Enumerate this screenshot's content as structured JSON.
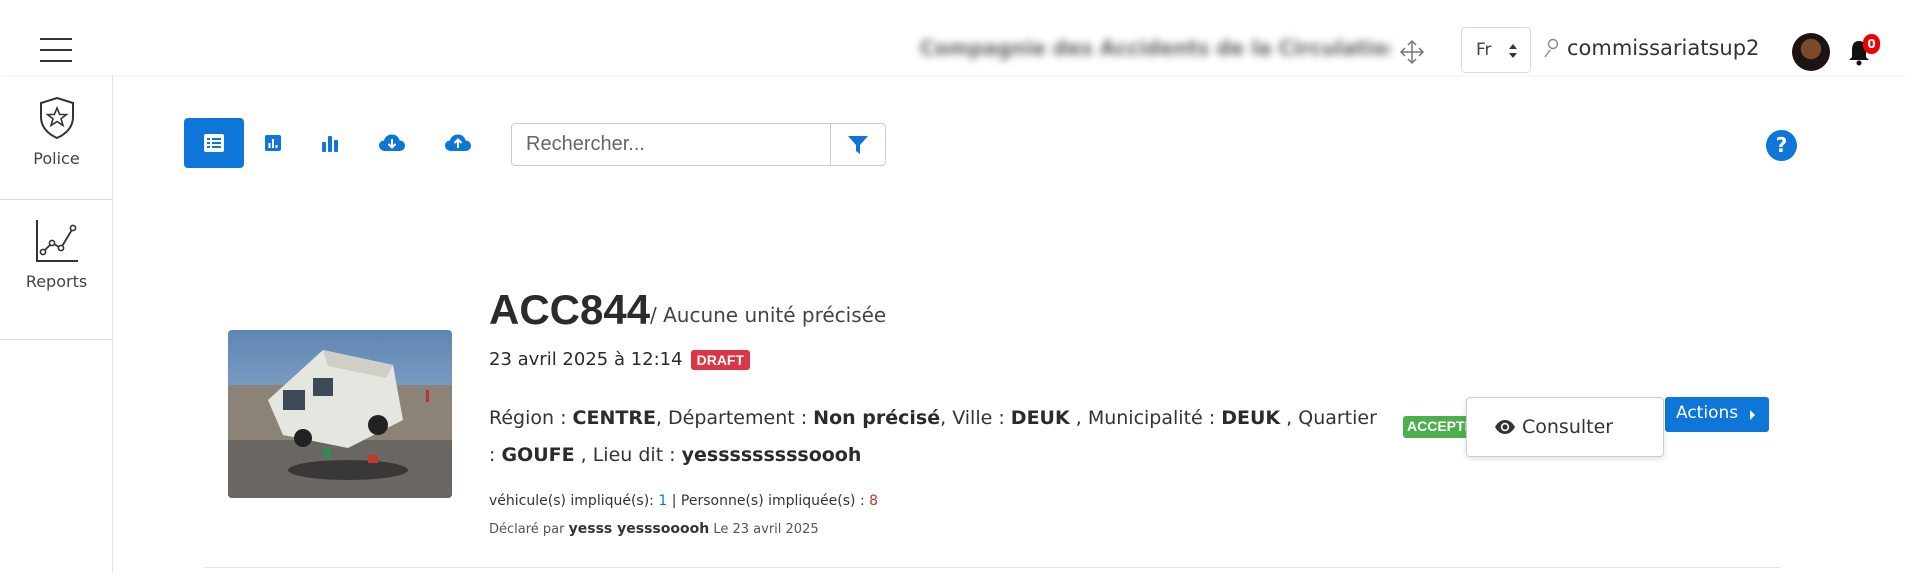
{
  "header": {
    "company_name": "Compagnie des Accidents de la Circulation DLA",
    "language": "Fr",
    "username": "commissariatsup2",
    "notification_count": "0"
  },
  "sidebar": {
    "items": [
      {
        "label": "Police",
        "icon": "shield-star-icon"
      },
      {
        "label": "Reports",
        "icon": "line-chart-icon"
      }
    ]
  },
  "toolbar": {
    "buttons": [
      "list-icon",
      "bar-chart-small-icon",
      "bar-chart-icon",
      "cloud-download-icon",
      "cloud-upload-icon"
    ],
    "search_placeholder": "Rechercher...",
    "help_label": "?"
  },
  "accident": {
    "code": "ACC844",
    "unit": "/ Aucune unité précisée",
    "datetime": "23 avril 2025 à 12:14",
    "status_badge": "DRAFT",
    "region_label": "Région :",
    "region": "CENTRE",
    "departement_label": ", Département :",
    "departement": "Non précisé",
    "ville_label": ", Ville :",
    "ville": "DEUK",
    "municipalite_label": ", Municipalité :",
    "municipalite": "DEUK",
    "quartier_label": ", Quartier :",
    "quartier": "GOUFE",
    "lieu_label": ", Lieu dit :",
    "lieu": "yesssssssssoooh",
    "vehicules_label": "véhicule(s) impliqué(s):",
    "vehicules_count": "1",
    "separator": "|",
    "personnes_label": "Personne(s) impliquée(s) :",
    "personnes_count": "8",
    "declared_by_label": "Déclaré par",
    "declared_by": "yesss yesssooooh",
    "declared_on": "Le 23 avril 2025",
    "accept_badge": "ACCEPTÉ"
  },
  "actions": {
    "button_label": "Actions",
    "menu": [
      {
        "label": "Consulter",
        "icon": "eye-icon"
      }
    ]
  },
  "colors": {
    "primary": "#0d76d8",
    "danger": "#dc3545",
    "success": "#4cae4c"
  }
}
